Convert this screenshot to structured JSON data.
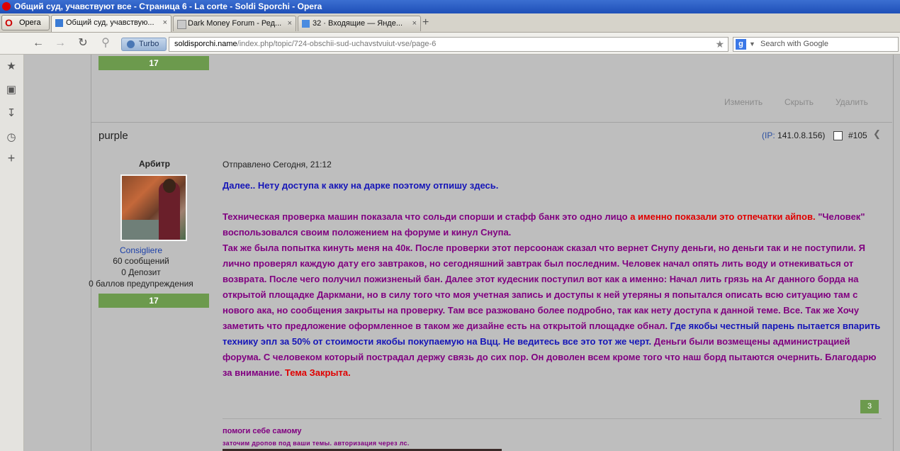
{
  "window": {
    "title": "Общий суд, учавствуют все - Страница 6 - La corte - Soldi Sporchi - Opera"
  },
  "tabs": {
    "opera_label": "Opera",
    "items": [
      {
        "label": "Общий суд, учавствую...",
        "close": "×"
      },
      {
        "label": "Dark Money Forum - Ред...",
        "close": "×"
      },
      {
        "label": "32 · Входящие — Яндe...",
        "close": "×"
      }
    ],
    "new_tab": "+"
  },
  "nav": {
    "turbo_label": "Turbo",
    "url_domain": "soldisporchi.name",
    "url_path": "/index.php/topic/724-obschii-sud-uchavstvuiut-vse/page-6",
    "search_placeholder": "Search with Google",
    "search_engine": "g"
  },
  "previous_post": {
    "rep": "17",
    "actions": {
      "edit": "Изменить",
      "hide": "Скрыть",
      "delete": "Удалить"
    }
  },
  "post": {
    "author": "purple",
    "ip_label": "(IP:",
    "ip": "141.0.8.156)",
    "number": "#105",
    "rank": "Арбитр",
    "group": "Consigliere",
    "posts_count": "60 сообщений",
    "deposit": "0 Депозит",
    "warnings": "0 баллов предупреждения",
    "author_rep": "17",
    "date": "Отправлено Сегодня, 21:12",
    "line1": "Далее.. Нету доступа к акку на дарке поэтому отпишу здесь.",
    "p2_a": "Техническая проверка машин показала что сольди спорши и стафф банк это одно лицо ",
    "p2_b": "а именно показали это отпечатки айпов.",
    "p2_c": " \"Человек\" воспользовался своим положением на форуме и кинул Снупа.",
    "p3_a": "Так же была попытка кинуть меня на 40к. После проверки этот персоонаж сказал что вернет Снупу деньги, но деньги так и не поступили. Я лично проверял каждую дату его завтраков, но сегодняшний завтрак был последним. Человек начал опять лить воду и отнекиваться от возврата. После чего получил пожизненый бан. Далее этот кудесник поступил вот как а именно: Начал лить грязь на Аг данного борда на открытой площадке Даркмани, но в силу того что моя учетная запись и доступы к ней утеряны я попытался описать всю ситуацию там с нового ака, но сообщения закрыты на проверку. Там все разжовано более подробно, так как нету доступа к данной теме. Все. Так же Хочу заметить что предложение оформленное в таком же дизайне есть на открытой площадке обнал. ",
    "p3_b": "Где якобы честный парень пытается впарить технику эпл за 50% от стоимости якобы покупаемую на Вцц. Не ведитесь все это тот же черт.",
    "p3_c": " Деньги были возмещены администрацией форума. С человеком который пострадал держу связь до сих пор. Он доволен всем кроме того что наш борд пытаются очернить. Благодарю за внимание. ",
    "p3_d": " Тема Закрыта.",
    "post_rep": "3",
    "signature_title": "помоги себе самому",
    "signature_sub": "заточим дропов под ваши темы. авторизация через лс."
  },
  "colors": {
    "purple_text": "#800080",
    "blue_text": "#1515b8",
    "red_text": "#e00000",
    "rep_green": "#6c9a4d"
  }
}
